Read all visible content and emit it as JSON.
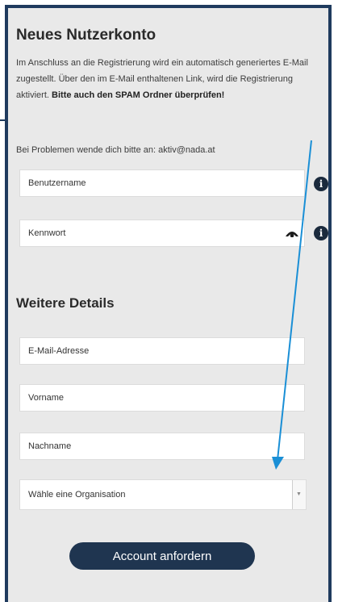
{
  "form": {
    "title": "Neues Nutzerkonto",
    "intro_text": "Im Anschluss an die Registrierung wird ein automatisch generiertes E-Mail zugestellt. Über den im E-Mail enthaltenen Link, wird die Registrierung aktiviert.",
    "intro_bold": "Bitte auch den SPAM Ordner überprüfen!",
    "contact_text": "Bei Problemen wende dich bitte an: aktiv@nada.at",
    "username_placeholder": "Benutzername",
    "password_placeholder": "Kennwort",
    "section_title": "Weitere Details",
    "email_placeholder": "E-Mail-Adresse",
    "firstname_placeholder": "Vorname",
    "lastname_placeholder": "Nachname",
    "organisation_selected": "Wähle eine Organisation",
    "submit_label": "Account anfordern",
    "info_glyph": "i"
  },
  "colors": {
    "accent": "#1f3550",
    "annotation_arrow": "#1a8fd6",
    "panel_background": "#e9e9e9"
  },
  "icons": [
    "info-icon",
    "eye-icon",
    "chevron-down-icon"
  ]
}
